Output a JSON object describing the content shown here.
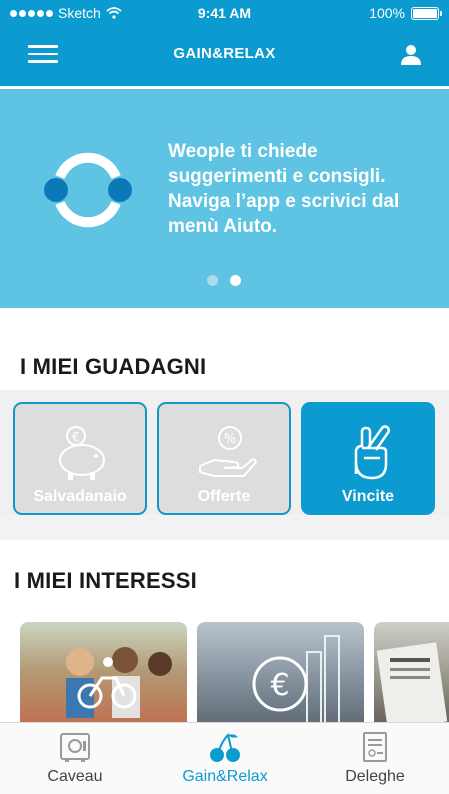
{
  "status_bar": {
    "carrier": "Sketch",
    "time": "9:41 AM",
    "battery": "100%"
  },
  "nav": {
    "title": "GAIN&RELAX",
    "menu_icon": "hamburger-menu-icon",
    "user_icon": "user-icon"
  },
  "hero": {
    "lines": [
      "Weople ti chiede",
      "suggerimenti e consigli.",
      "Naviga l’app e scrivici dal",
      "menù Aiuto."
    ],
    "logo_icon": "weople-logo-icon",
    "pager_total": 2,
    "pager_active": 2
  },
  "guadagni": {
    "title": "I MIEI GUADAGNI",
    "cards": [
      {
        "label": "Salvadanaio",
        "icon": "piggy-bank-icon",
        "selected": false
      },
      {
        "label": "Offerte",
        "icon": "offer-hand-icon",
        "selected": false
      },
      {
        "label": "Vincite",
        "icon": "crossed-fingers-icon",
        "selected": true
      }
    ]
  },
  "interessi": {
    "title": "I MIEI INTERESSI",
    "items": [
      {
        "icon": "cyclist-icon"
      },
      {
        "icon": "euro-chart-icon"
      },
      {
        "icon": "newspaper-icon"
      }
    ]
  },
  "tabbar": {
    "tabs": [
      {
        "label": "Caveau",
        "icon": "safe-icon",
        "active": false
      },
      {
        "label": "Gain&Relax",
        "icon": "cherries-icon",
        "active": true
      },
      {
        "label": "Deleghe",
        "icon": "document-icon",
        "active": false
      }
    ]
  },
  "colors": {
    "primary": "#0c9bd0",
    "hero_bg": "#5fc4e3",
    "tab_active": "#0c9bd0",
    "tab_inactive": "#444444"
  }
}
